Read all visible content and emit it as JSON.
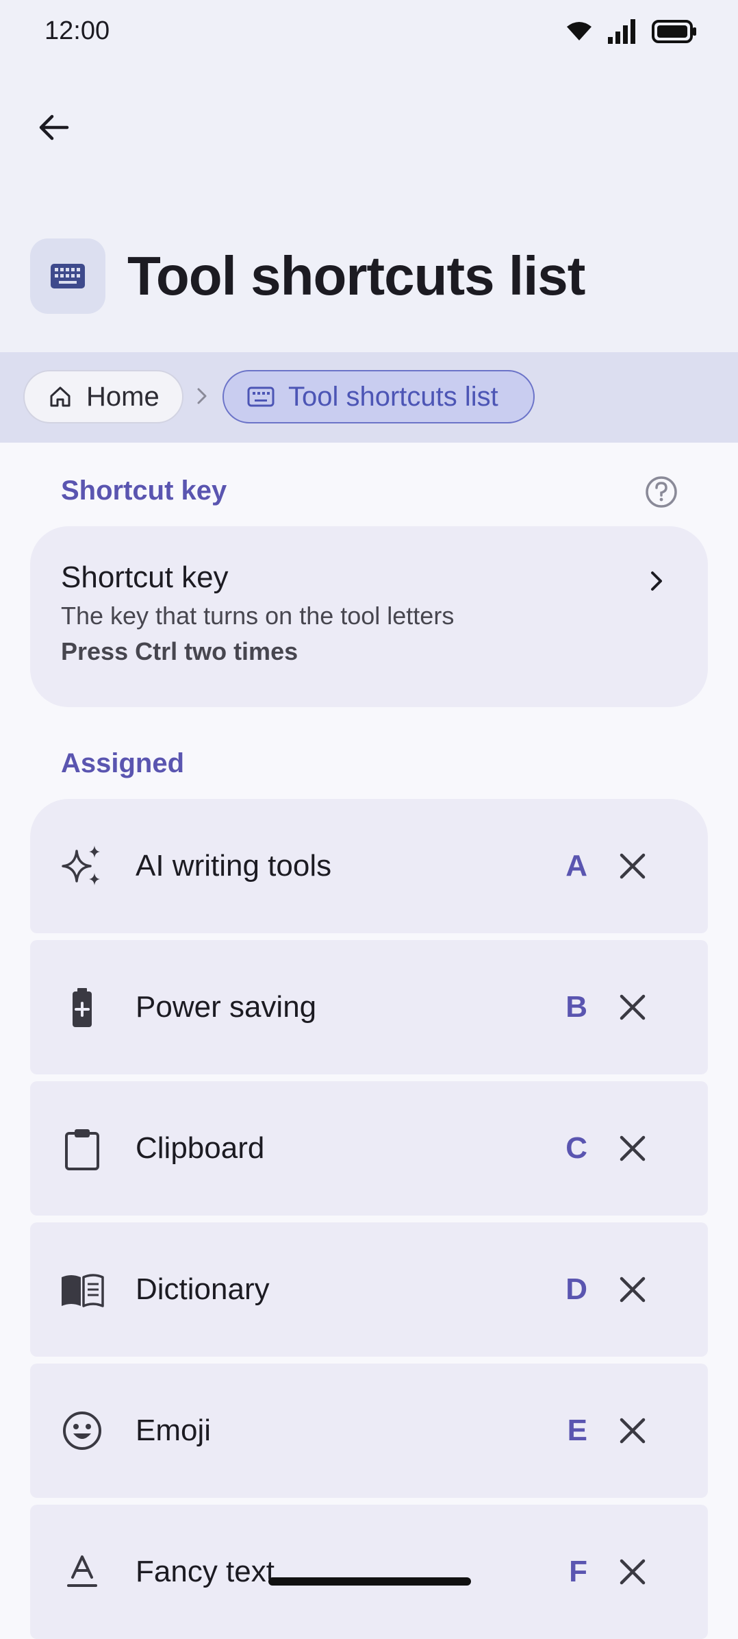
{
  "status_bar": {
    "time": "12:00"
  },
  "header": {
    "title": "Tool shortcuts list"
  },
  "breadcrumb": {
    "home": "Home",
    "current": "Tool shortcuts list"
  },
  "shortcut_section": {
    "header": "Shortcut key",
    "card": {
      "title": "Shortcut key",
      "description": "The key that turns on the tool letters",
      "value": "Press Ctrl two times"
    }
  },
  "assigned_section": {
    "header": "Assigned",
    "items": [
      {
        "icon": "sparkle-icon",
        "label": "AI writing tools",
        "key": "A"
      },
      {
        "icon": "battery-icon",
        "label": "Power saving",
        "key": "B"
      },
      {
        "icon": "clipboard-icon",
        "label": "Clipboard",
        "key": "C"
      },
      {
        "icon": "book-icon",
        "label": "Dictionary",
        "key": "D"
      },
      {
        "icon": "emoji-icon",
        "label": "Emoji",
        "key": "E"
      },
      {
        "icon": "text-style-icon",
        "label": "Fancy text",
        "key": "F"
      }
    ]
  },
  "colors": {
    "accent": "#5a55b0",
    "background": "#f8f8fc",
    "card": "#ecebf6",
    "breadcrumb_bar": "#dcdef0"
  }
}
